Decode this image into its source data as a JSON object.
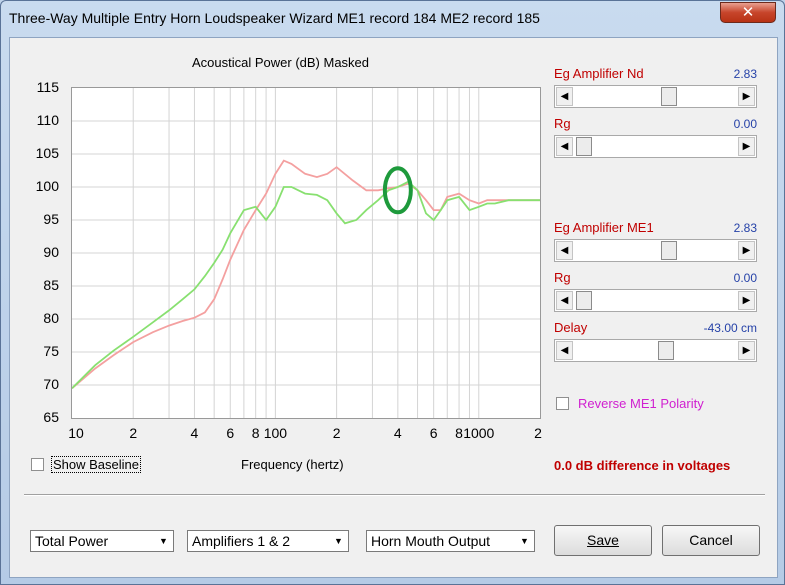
{
  "window": {
    "title": "Three-Way Multiple Entry Horn Loudspeaker Wizard    ME1 record 184    ME2 record 185",
    "close_glyph": "✕"
  },
  "chart": {
    "title": "Acoustical Power (dB)   Masked",
    "xlabel": "Frequency (hertz)"
  },
  "chart_data": {
    "type": "line",
    "title": "Acoustical Power (dB)   Masked",
    "xlabel": "Frequency (hertz)",
    "ylabel": "",
    "x_scale": "log",
    "xlim": [
      10,
      2000
    ],
    "ylim": [
      65,
      115
    ],
    "y_ticks": [
      115,
      110,
      105,
      100,
      95,
      90,
      85,
      80,
      75,
      70,
      65
    ],
    "x_ticks": [
      {
        "value": 10,
        "label": "10"
      },
      {
        "value": 20,
        "label": "2"
      },
      {
        "value": 40,
        "label": "4"
      },
      {
        "value": 60,
        "label": "6"
      },
      {
        "value": 80,
        "label": "8"
      },
      {
        "value": 100,
        "label": "100"
      },
      {
        "value": 200,
        "label": "2"
      },
      {
        "value": 400,
        "label": "4"
      },
      {
        "value": 600,
        "label": "6"
      },
      {
        "value": 800,
        "label": "8"
      },
      {
        "value": 1000,
        "label": "1000"
      },
      {
        "value": 2000,
        "label": "2"
      }
    ],
    "grid": true,
    "series": [
      {
        "color": "#f4a0a0",
        "x": [
          10,
          13,
          16,
          20,
          25,
          30,
          35,
          40,
          45,
          50,
          55,
          60,
          70,
          80,
          90,
          100,
          110,
          120,
          140,
          160,
          180,
          200,
          240,
          280,
          320,
          360,
          400,
          450,
          500,
          550,
          600,
          650,
          700,
          800,
          900,
          1000,
          1100,
          1200,
          1400,
          1600,
          1800,
          2000
        ],
        "y": [
          69.5,
          72.5,
          74.5,
          76.5,
          78,
          79,
          79.7,
          80.2,
          81,
          83,
          86,
          89,
          93.5,
          96.5,
          99,
          102,
          104,
          103.5,
          102,
          101.5,
          102,
          103,
          101,
          99.5,
          99.5,
          99.8,
          100,
          100.5,
          99.5,
          98,
          96.5,
          96.5,
          98.5,
          99,
          98,
          97.5,
          98,
          98,
          98,
          98,
          98,
          98
        ]
      },
      {
        "color": "#88e070",
        "x": [
          10,
          13,
          16,
          20,
          25,
          30,
          35,
          40,
          45,
          50,
          55,
          60,
          70,
          80,
          90,
          100,
          110,
          120,
          140,
          160,
          180,
          200,
          220,
          250,
          280,
          320,
          360,
          400,
          450,
          500,
          550,
          600,
          650,
          700,
          800,
          900,
          1000,
          1100,
          1200,
          1400,
          1600,
          1800,
          2000
        ],
        "y": [
          69.5,
          73,
          75.2,
          77.3,
          79.5,
          81.3,
          83,
          84.5,
          86.5,
          88.5,
          90.5,
          93,
          96.5,
          97,
          95,
          97,
          100,
          100,
          99,
          98.8,
          98,
          96,
          94.5,
          95,
          96.5,
          98,
          99.5,
          100,
          100.8,
          99.5,
          96,
          95,
          96.5,
          98,
          98.5,
          96.5,
          97,
          97.5,
          97.5,
          98,
          98,
          98,
          98
        ]
      }
    ],
    "annotations": [
      {
        "type": "ellipse",
        "x": 400,
        "y": 99.5,
        "color": "#1e9a3c"
      }
    ]
  },
  "show_baseline": {
    "label": "Show Baseline",
    "checked": false
  },
  "sliders": [
    {
      "label": "Eg  Amplifier  Nd",
      "value": "2.83",
      "pos": 0.32
    },
    {
      "label": "Rg",
      "value": "0.00",
      "pos": 0.0
    },
    {
      "label": "Eg  Amplifier  ME1",
      "value": "2.83",
      "pos": 0.32
    },
    {
      "label": "Rg",
      "value": "0.00",
      "pos": 0.0
    },
    {
      "label": "Delay",
      "value": "-43.00 cm",
      "pos": 0.3
    }
  ],
  "reverse_polarity": {
    "label": "Reverse ME1 Polarity",
    "checked": false
  },
  "difference_text": "0.0 dB difference in voltages",
  "combos": [
    {
      "value": "Total Power"
    },
    {
      "value": "Amplifiers 1 & 2"
    },
    {
      "value": "Horn Mouth Output"
    }
  ],
  "buttons": {
    "save": "Save",
    "cancel": "Cancel"
  },
  "colors": {
    "series_red": "#f4a0a0",
    "series_green": "#88e070",
    "annotation_green": "#1e9a3c",
    "label_red": "#c00000",
    "value_blue": "#2642a8",
    "polarity_magenta": "#d020d0"
  },
  "icons": {
    "left": "◀",
    "right": "▶",
    "down": "▼"
  }
}
